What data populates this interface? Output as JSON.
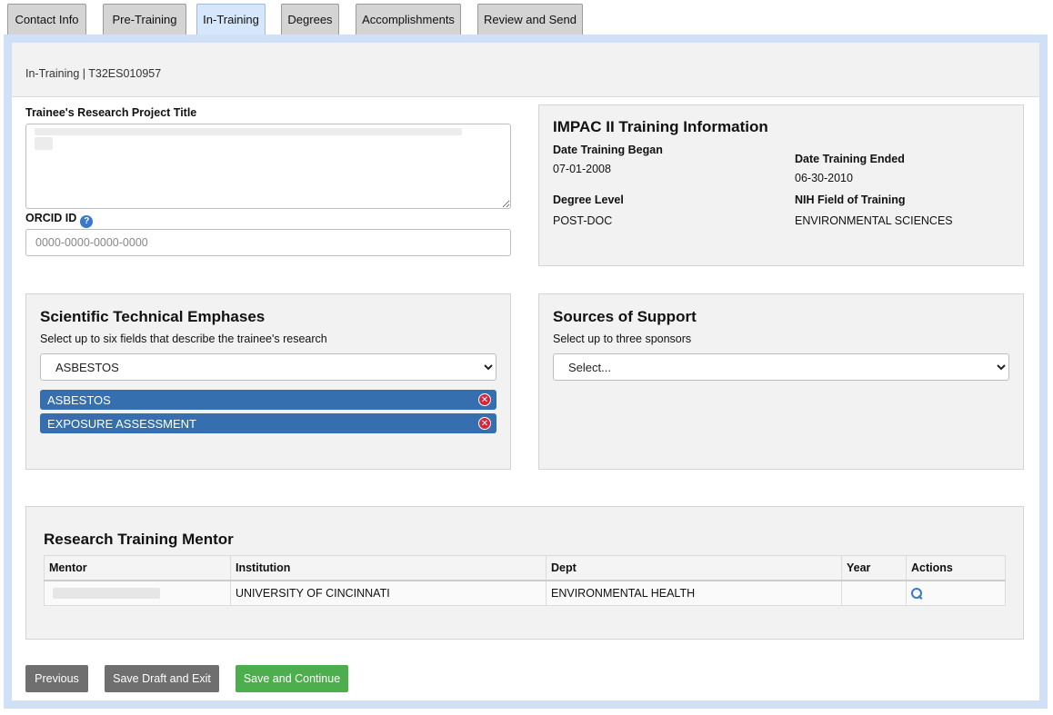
{
  "tabs": [
    {
      "label": "Contact Info",
      "active": false
    },
    {
      "label": "Pre-Training",
      "active": false
    },
    {
      "label": "In-Training",
      "active": true
    },
    {
      "label": "Degrees",
      "active": false
    },
    {
      "label": "Accomplishments",
      "active": false
    },
    {
      "label": "Review and Send",
      "active": false
    }
  ],
  "header": {
    "title": "In-Training | T32ES010957"
  },
  "project": {
    "title_label": "Trainee's Research Project Title",
    "orcid_label": "ORCID ID",
    "orcid_help_icon": "?",
    "orcid_placeholder": "0000-0000-0000-0000"
  },
  "impac": {
    "heading": "IMPAC II Training Information",
    "began_label": "Date Training Began",
    "began_value": "07-01-2008",
    "ended_label": "Date Training Ended",
    "ended_value": "06-30-2010",
    "degree_label": "Degree Level",
    "degree_value": "POST-DOC",
    "field_label": "NIH Field of Training",
    "field_value": "ENVIRONMENTAL SCIENCES"
  },
  "emphases": {
    "heading": "Scientific Technical Emphases",
    "instructions": "Select up to six fields that describe the trainee's research",
    "selected": "ASBESTOS",
    "chips": [
      "ASBESTOS",
      "EXPOSURE ASSESSMENT"
    ],
    "remove_glyph": "✕"
  },
  "support": {
    "heading": "Sources of Support",
    "instructions": "Select up to three sponsors",
    "selected": "Select..."
  },
  "mentor": {
    "heading": "Research Training Mentor",
    "columns": [
      "Mentor",
      "Institution",
      "Dept",
      "Year",
      "Actions"
    ],
    "rows": [
      {
        "mentor": "",
        "institution": "UNIVERSITY OF CINCINNATI",
        "dept": "ENVIRONMENTAL HEALTH",
        "year": ""
      }
    ]
  },
  "buttons": {
    "previous": "Previous",
    "save_draft": "Save Draft and Exit",
    "save_continue": "Save and Continue"
  },
  "colors": {
    "accent_blue": "#356faf",
    "frame_blue": "#cfe0f7",
    "active_tab": "#d6e6fb",
    "continue_green": "#4cae4c",
    "remove_red": "#d3273a"
  },
  "icons": {
    "view_action": "magnifier-icon",
    "help": "help-icon",
    "remove": "remove-icon"
  }
}
